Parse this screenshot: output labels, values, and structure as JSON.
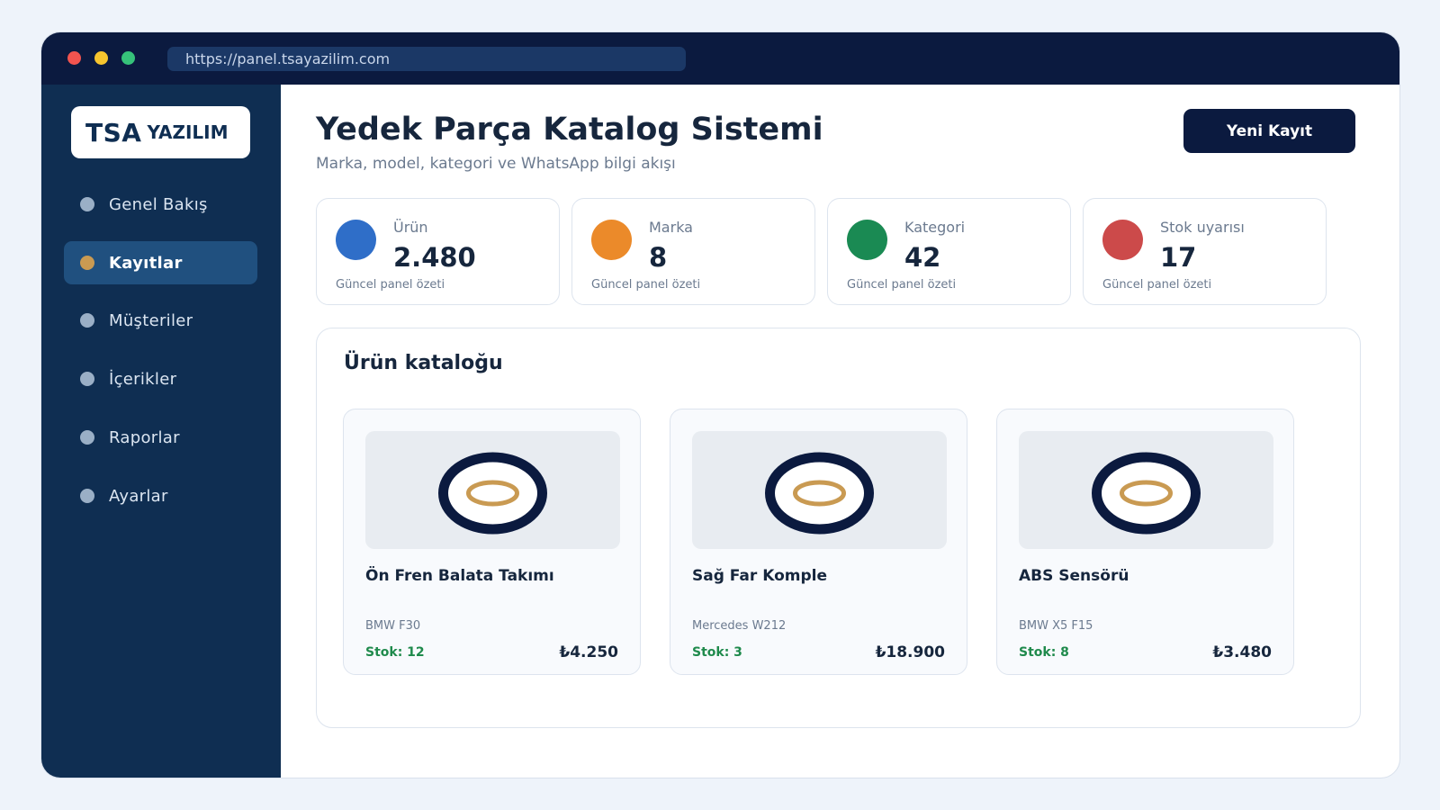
{
  "browser": {
    "url": "https://panel.tsayazilim.com"
  },
  "sidebar": {
    "logo": {
      "primary": "TSA",
      "secondary": "YAZILIM"
    },
    "items": [
      {
        "label": "Genel Bakış",
        "active": false
      },
      {
        "label": "Kayıtlar",
        "active": true
      },
      {
        "label": "Müşteriler",
        "active": false
      },
      {
        "label": "İçerikler",
        "active": false
      },
      {
        "label": "Raporlar",
        "active": false
      },
      {
        "label": "Ayarlar",
        "active": false
      }
    ]
  },
  "header": {
    "title": "Yedek Parça Katalog Sistemi",
    "subtitle": "Marka, model, kategori ve WhatsApp bilgi akışı",
    "new_button_label": "Yeni Kayıt"
  },
  "stats": [
    {
      "label": "Ürün",
      "value": "2.480",
      "footer": "Güncel panel özeti",
      "color": "#2f6ec8"
    },
    {
      "label": "Marka",
      "value": "8",
      "footer": "Güncel panel özeti",
      "color": "#eb8a2a"
    },
    {
      "label": "Kategori",
      "value": "42",
      "footer": "Güncel panel özeti",
      "color": "#1a8a53"
    },
    {
      "label": "Stok uyarısı",
      "value": "17",
      "footer": "Güncel panel özeti",
      "color": "#cc4a4a"
    }
  ],
  "catalog": {
    "title": "Ürün kataloğu",
    "products": [
      {
        "name": "Ön Fren Balata Takımı",
        "model": "BMW F30",
        "stock": "Stok: 12",
        "price": "₺4.250"
      },
      {
        "name": "Sağ Far Komple",
        "model": "Mercedes W212",
        "stock": "Stok: 3",
        "price": "₺18.900"
      },
      {
        "name": "ABS Sensörü",
        "model": "BMW X5 F15",
        "stock": "Stok: 8",
        "price": "₺3.480"
      }
    ]
  },
  "colors": {
    "navy": "#0b1a3f",
    "sidebar": "#0f2e52",
    "accent_gold": "#c99a52",
    "stock_green": "#1f8a4c"
  },
  "icons": {
    "product_image": "tire-ring-icon"
  }
}
